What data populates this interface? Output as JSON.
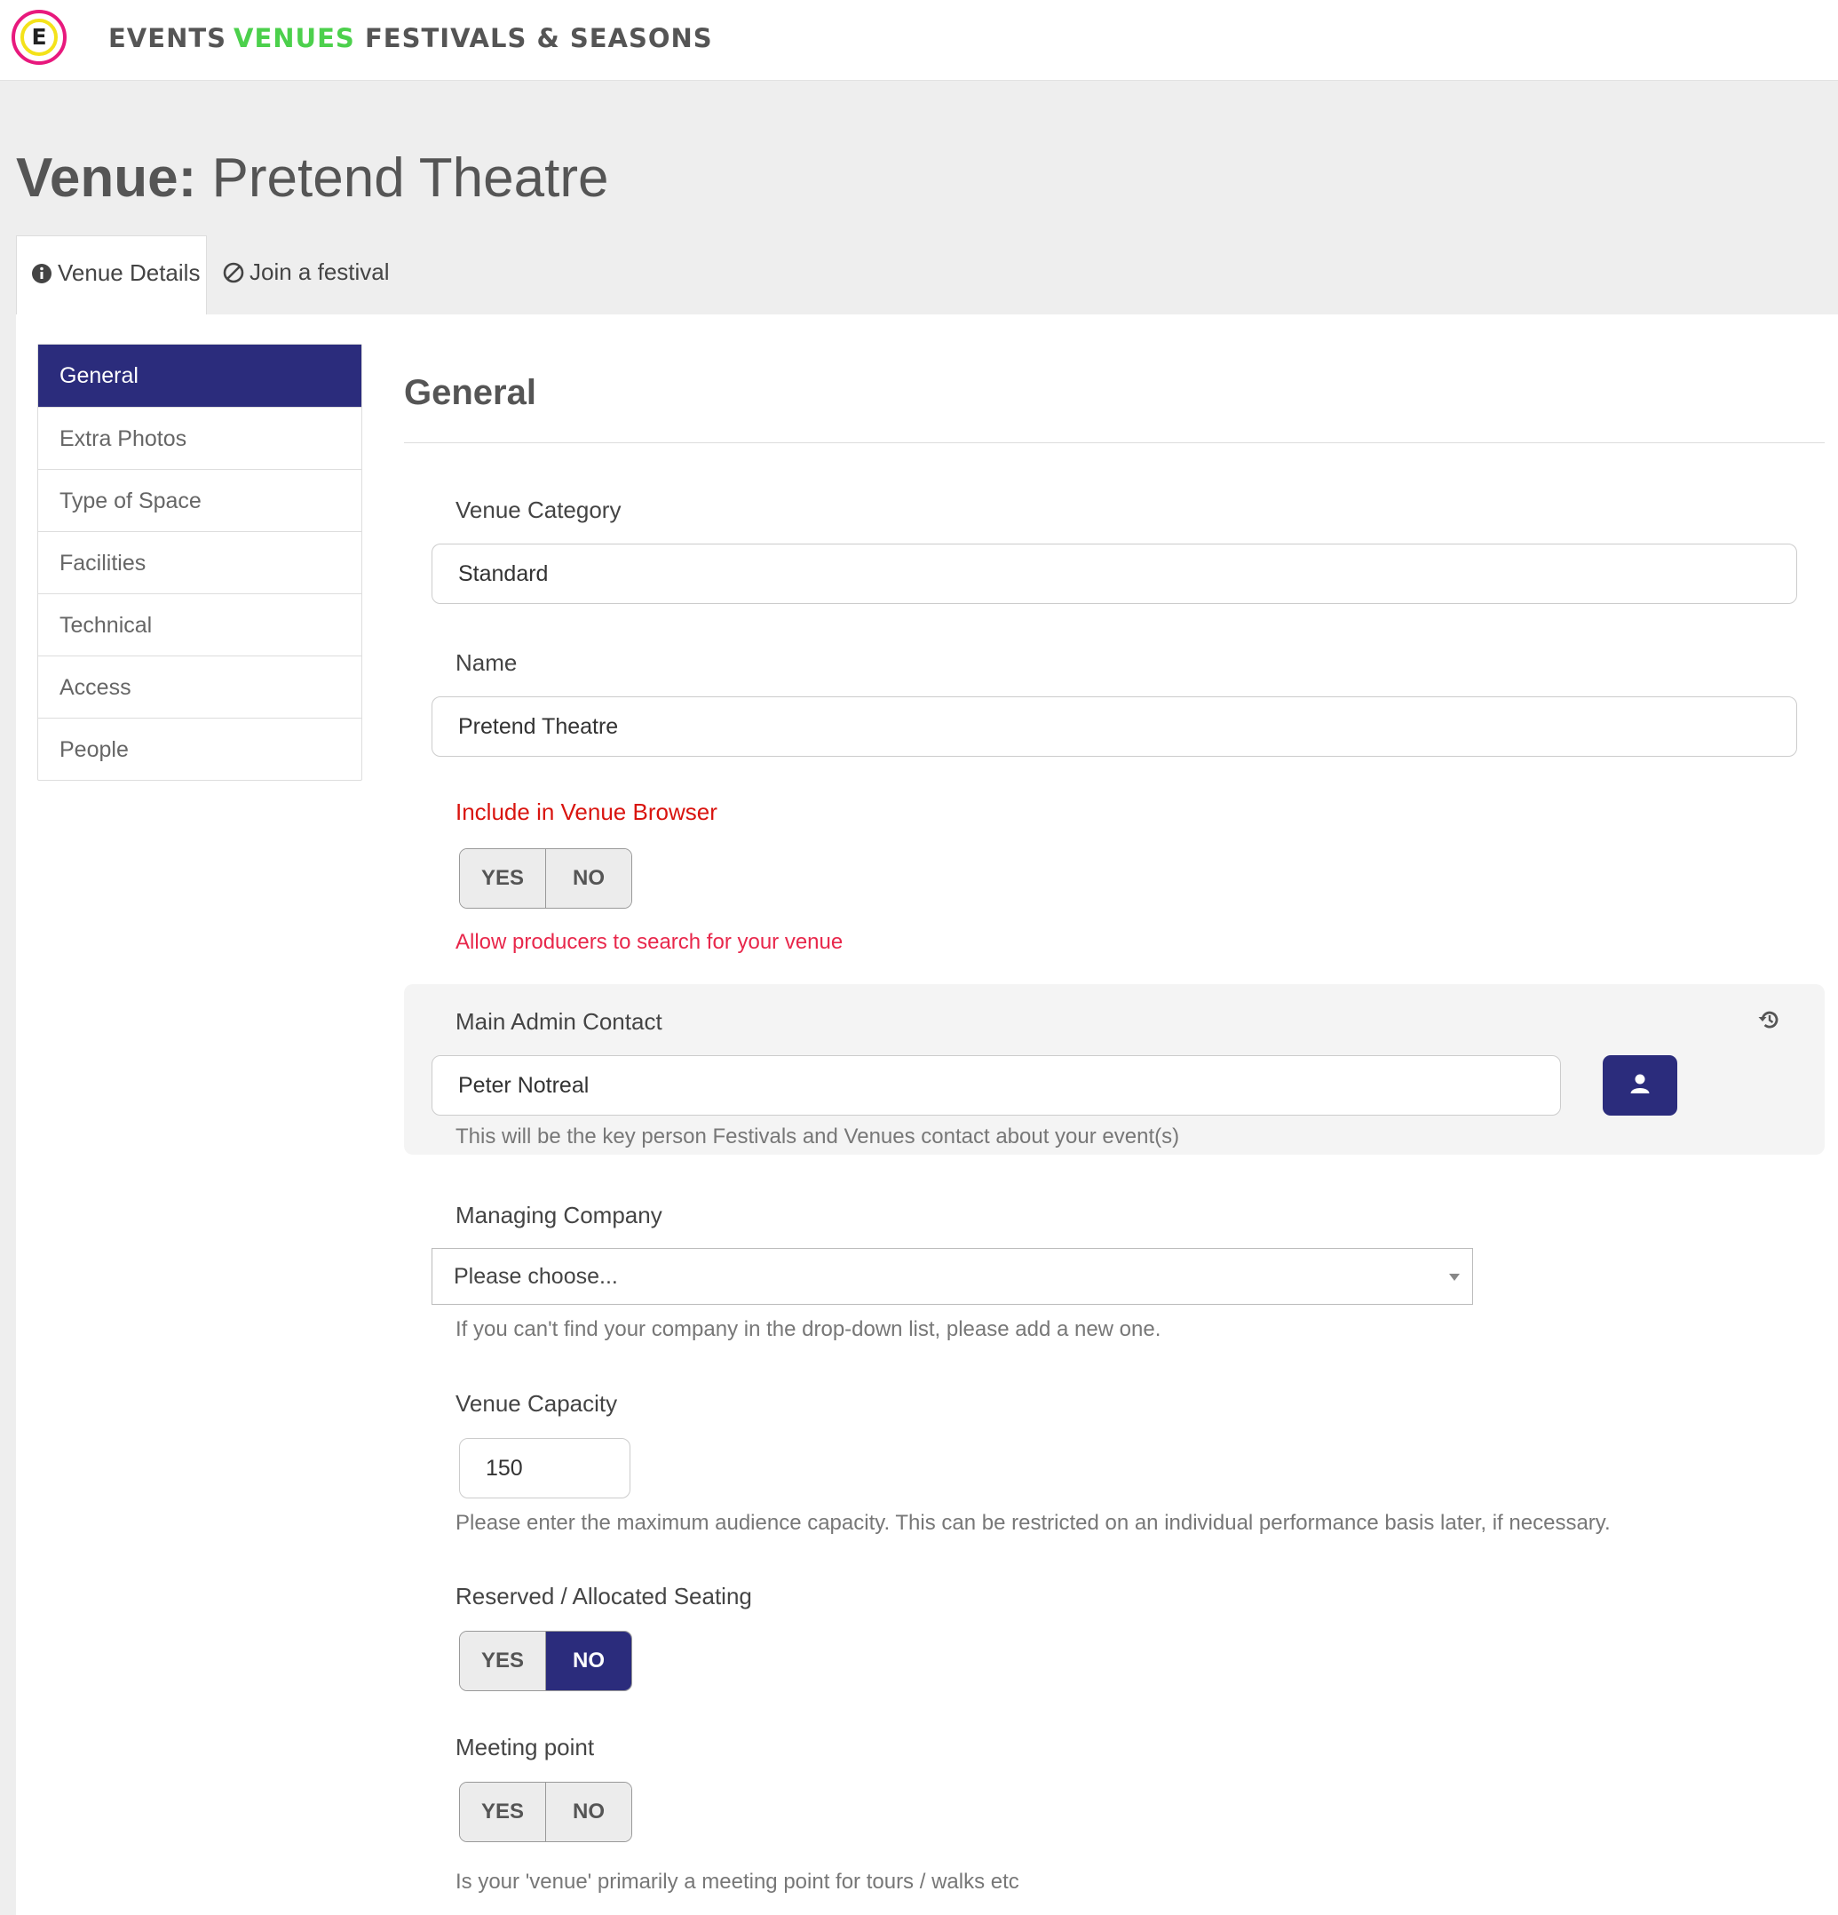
{
  "nav": {
    "logo_letter": "E",
    "links": [
      "EVENTS",
      "VENUES",
      "FESTIVALS & SEASONS"
    ],
    "active": "VENUES",
    "active_color": "#4cd04c"
  },
  "header": {
    "title_prefix": "Venue:",
    "title_name": "Pretend Theatre",
    "tabs": [
      {
        "label": "Venue Details",
        "icon": "info-circle-icon"
      },
      {
        "label": "Join a festival",
        "icon": "ban-icon"
      }
    ]
  },
  "sidebar": {
    "items": [
      "General",
      "Extra Photos",
      "Type of Space",
      "Facilities",
      "Technical",
      "Access",
      "People"
    ],
    "active": "General",
    "accent_color": "#2b2c7c"
  },
  "form": {
    "section_title": "General",
    "venue_category": {
      "label": "Venue Category",
      "value": "Standard"
    },
    "name": {
      "label": "Name",
      "value": "Pretend Theatre"
    },
    "include_in_browser": {
      "label": "Include in Venue Browser",
      "yes": "YES",
      "no": "NO",
      "selected": null,
      "help": "Allow producers to search for your venue"
    },
    "main_admin_contact": {
      "label": "Main Admin Contact",
      "value": "Peter Notreal",
      "help": "This will be the key person Festivals and Venues contact about your event(s)",
      "button_icon": "user-icon",
      "history_icon": "history-icon"
    },
    "managing_company": {
      "label": "Managing Company",
      "selected": "Please choose...",
      "help": "If you can't find your company in the drop-down list, please add a new one."
    },
    "venue_capacity": {
      "label": "Venue Capacity",
      "value": "150",
      "help": "Please enter the maximum audience capacity. This can be restricted on an individual performance basis later, if necessary."
    },
    "reserved_seating": {
      "label": "Reserved / Allocated Seating",
      "yes": "YES",
      "no": "NO",
      "selected": "NO"
    },
    "meeting_point": {
      "label": "Meeting point",
      "yes": "YES",
      "no": "NO",
      "selected": null,
      "help": "Is your 'venue' primarily a meeting point for tours / walks etc"
    }
  }
}
